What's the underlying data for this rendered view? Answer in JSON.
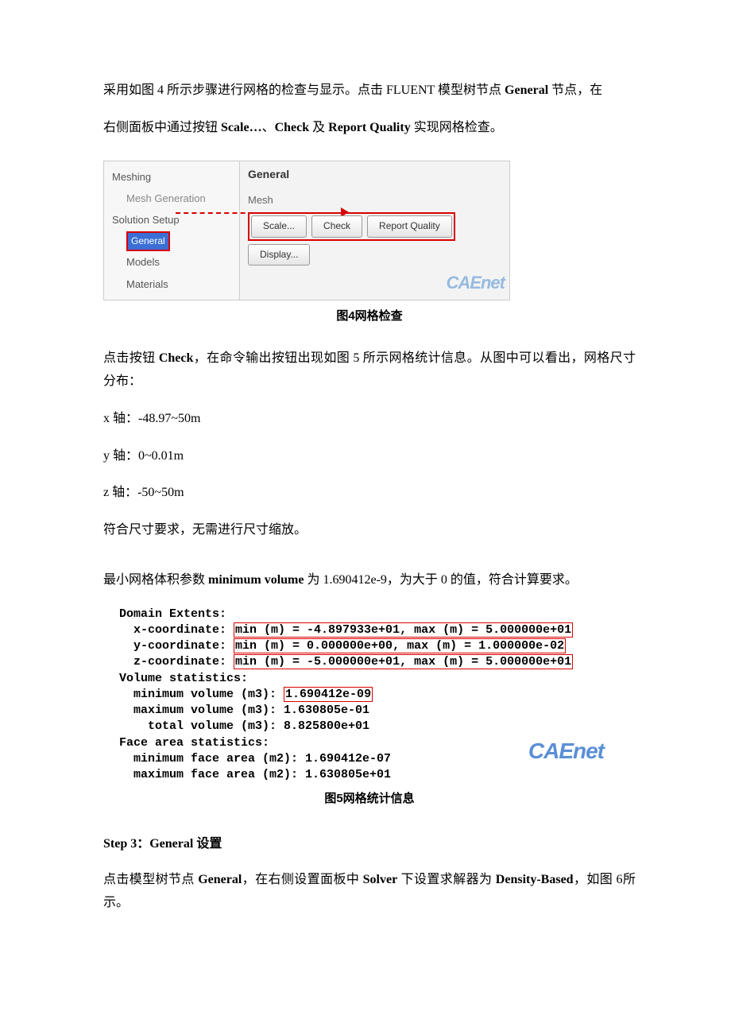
{
  "p1_a": "采用如图 4 所示步骤进行网格的检查与显示。点击 FLUENT 模型树节点 ",
  "p1_b": "General",
  "p1_c": " 节点，在",
  "p2_a": "右侧面板中通过按钮 ",
  "p2_b": "Scale…",
  "p2_c": "、",
  "p2_d": "Check",
  "p2_e": " 及 ",
  "p2_f": "Report Quality",
  "p2_g": " 实现网格检查。",
  "fig4": {
    "tree": {
      "meshing": "Meshing",
      "mesh_gen": "Mesh Generation",
      "setup": "Solution Setup",
      "general": "General",
      "models": "Models",
      "materials": "Materials"
    },
    "panel": {
      "title": "General",
      "sub": "Mesh",
      "scale": "Scale...",
      "check": "Check",
      "report": "Report Quality",
      "display": "Display..."
    },
    "watermark": "CAEnet"
  },
  "cap4": "图4网格检查",
  "p3_a": "点击按钮 ",
  "p3_b": "Check",
  "p3_c": "，在命令输出按钮出现如图 5 所示网格统计信息。从图中可以看出，网格尺寸分布：",
  "p4": "x 轴：-48.97~50m",
  "p5": "y 轴：0~0.01m",
  "p6": "z 轴：-50~50m",
  "p7": "符合尺寸要求，无需进行尺寸缩放。",
  "p8_a": "最小网格体积参数 ",
  "p8_b": "minimum volume",
  "p8_c": " 为 1.690412e-9，为大于 0 的值，符合计算要求。",
  "fig5": {
    "l1": "Domain Extents:",
    "l2a": "  x-coordinate: ",
    "l2b": "min (m) = -4.897933e+01, max (m) = 5.000000e+01",
    "l3a": "  y-coordinate: ",
    "l3b": "min (m) = 0.000000e+00, max (m) = 1.000000e-02",
    "l4a": "  z-coordinate: ",
    "l4b": "min (m) = -5.000000e+01, max (m) = 5.000000e+01",
    "l5": "Volume statistics:",
    "l6a": "  minimum volume (m3): ",
    "l6b": "1.690412e-09",
    "l7": "  maximum volume (m3): 1.630805e-01",
    "l8": "    total volume (m3): 8.825800e+01",
    "l9": "Face area statistics:",
    "l10": "  minimum face area (m2): 1.690412e-07",
    "l11": "  maximum face area (m2): 1.630805e+01",
    "watermark": "CAEnet"
  },
  "cap5": "图5网格统计信息",
  "step3": "Step 3：General 设置",
  "p9_a": "点击模型树节点 ",
  "p9_b": "General",
  "p9_c": "，在右侧设置面板中 ",
  "p9_d": "Solver",
  "p9_e": " 下设置求解器为 ",
  "p9_f": "Density-Based",
  "p9_g": "，如图 6所示。"
}
